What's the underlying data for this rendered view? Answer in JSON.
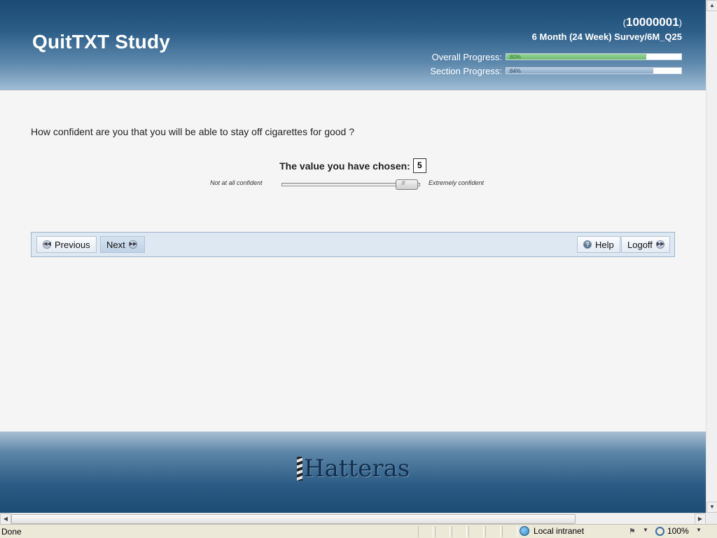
{
  "header": {
    "app_title": "QuitTXT Study",
    "participant_open": "(",
    "participant_id": "10000001",
    "participant_close": ")",
    "survey_name": "6 Month (24 Week) Survey/6M_Q25",
    "overall_label": "Overall Progress:",
    "overall_percent": 80,
    "overall_text": "80%",
    "section_label": "Section Progress:",
    "section_percent": 84,
    "section_text": "84%"
  },
  "question": {
    "text": "How confident are you that you will be able to stay off cigarettes for good ?",
    "chosen_label": "The value you have chosen:",
    "chosen_value": "5",
    "slider_min_label": "Not at all confident",
    "slider_max_label": "Extremely confident"
  },
  "nav": {
    "previous": "Previous",
    "next": "Next",
    "help": "Help",
    "logoff": "Logoff"
  },
  "footer": {
    "logo_text": "Hatteras"
  },
  "statusbar": {
    "status": "Done",
    "zone": "Local intranet",
    "zoom": "100%"
  },
  "colors": {
    "header_top": "#1b4a73",
    "progress_green": "#6fbc6f",
    "progress_blue": "#8aa9c6",
    "nav_bg": "#dde8f3"
  },
  "icons": [
    "previous-icon",
    "next-icon",
    "help-icon",
    "logoff-icon",
    "lighthouse-icon",
    "globe-icon",
    "protected-mode-icon",
    "zoom-icon"
  ]
}
